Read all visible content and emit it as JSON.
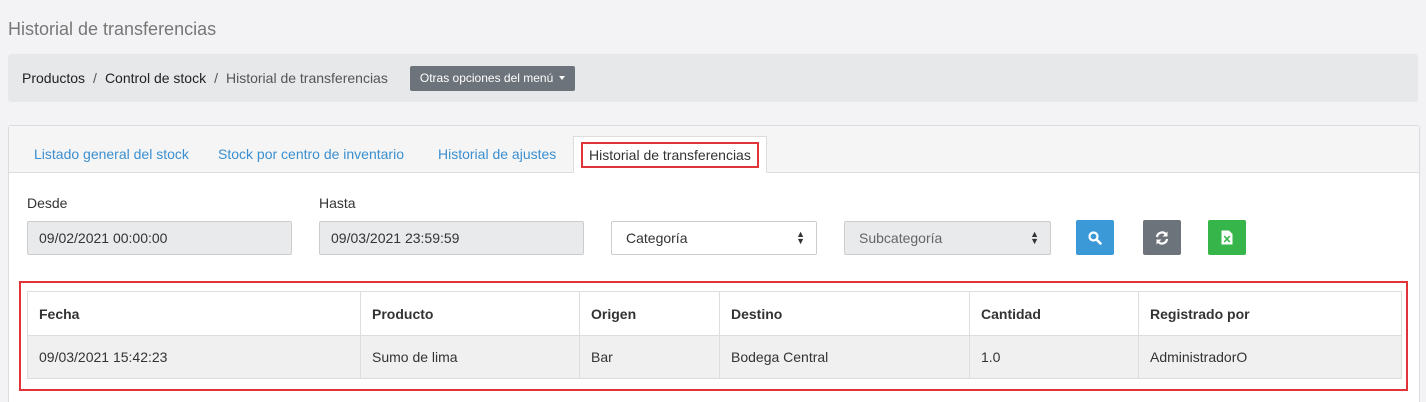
{
  "page": {
    "title": "Historial de transferencias"
  },
  "breadcrumb": {
    "items": [
      "Productos",
      "Control de stock",
      "Historial de transferencias"
    ],
    "menu_button": "Otras opciones del menú"
  },
  "tabs": [
    {
      "label": "Listado general del stock"
    },
    {
      "label": "Stock por centro de inventario"
    },
    {
      "label": "Historial de ajustes"
    },
    {
      "label": "Historial de transferencias",
      "active": true
    }
  ],
  "filters": {
    "desde_label": "Desde",
    "desde_value": "09/02/2021 00:00:00",
    "hasta_label": "Hasta",
    "hasta_value": "09/03/2021 23:59:59",
    "categoria": "Categoría",
    "subcategoria": "Subcategoría"
  },
  "actions": {
    "search_icon": "search-icon",
    "refresh_icon": "refresh-icon",
    "excel_icon": "excel-icon",
    "colors": {
      "search": "#3b99d8",
      "refresh": "#6d737a",
      "excel": "#36b54a",
      "highlight": "#e0333a"
    }
  },
  "table": {
    "headers": [
      "Fecha",
      "Producto",
      "Origen",
      "Destino",
      "Cantidad",
      "Registrado por"
    ],
    "rows": [
      [
        "09/03/2021 15:42:23",
        "Sumo de lima",
        "Bar",
        "Bodega Central",
        "1.0",
        "AdministradorO"
      ]
    ]
  }
}
